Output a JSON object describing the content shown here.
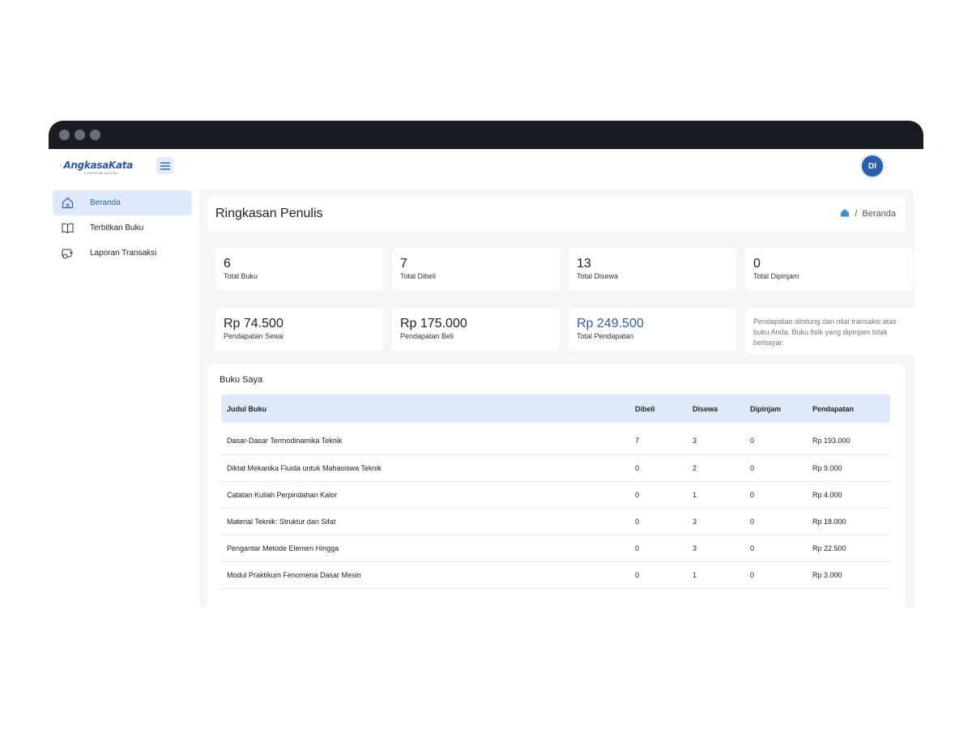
{
  "app": {
    "logo_text": "AngkasaKata",
    "logo_subtext": "LITERATUR DIGITAL",
    "avatar_initials": "DI",
    "accent_color": "#2b5fab"
  },
  "sidebar": {
    "items": [
      {
        "label": "Beranda",
        "icon": "home-icon",
        "active": true
      },
      {
        "label": "Terbitkan Buku",
        "icon": "book-open-icon",
        "active": false
      },
      {
        "label": "Laporan Transaksi",
        "icon": "transaction-report-icon",
        "active": false
      }
    ]
  },
  "header": {
    "title": "Ringkasan Penulis",
    "breadcrumb_separator": "/",
    "breadcrumb_current": "Beranda"
  },
  "stats": [
    {
      "value": "6",
      "label": "Total Buku"
    },
    {
      "value": "7",
      "label": "Total Dibeli"
    },
    {
      "value": "13",
      "label": "Total Disewa"
    },
    {
      "value": "0",
      "label": "Total Dipinjam"
    }
  ],
  "revenue": [
    {
      "value": "Rp 74.500",
      "label": "Pendapatan Sewa"
    },
    {
      "value": "Rp 175.000",
      "label": "Pendapatan Beli"
    },
    {
      "value": "Rp 249.500",
      "label": "Total Pendapatan"
    }
  ],
  "note": "Pendapatan dihitung dari nilai transaksi atas buku Anda. Buku fisik yang dipinjam tidak berbayar.",
  "books": {
    "title": "Buku Saya",
    "columns": [
      "Judul Buku",
      "Dibeli",
      "Disewa",
      "Dipinjam",
      "Pendapatan"
    ],
    "rows": [
      [
        "Dasar-Dasar Termodinamika Teknik",
        "7",
        "3",
        "0",
        "Rp 193.000"
      ],
      [
        "Diktat Mekanika Fluida untuk Mahasiswa Teknik",
        "0",
        "2",
        "0",
        "Rp 9.000"
      ],
      [
        "Catatan Kuliah Perpindahan Kalor",
        "0",
        "1",
        "0",
        "Rp 4.000"
      ],
      [
        "Material Teknik: Struktur dan Sifat",
        "0",
        "3",
        "0",
        "Rp 18.000"
      ],
      [
        "Pengantar Metode Elemen Hingga",
        "0",
        "3",
        "0",
        "Rp 22.500"
      ],
      [
        "Modul Praktikum Fenomena Dasar Mesin",
        "0",
        "1",
        "0",
        "Rp 3.000"
      ]
    ]
  }
}
